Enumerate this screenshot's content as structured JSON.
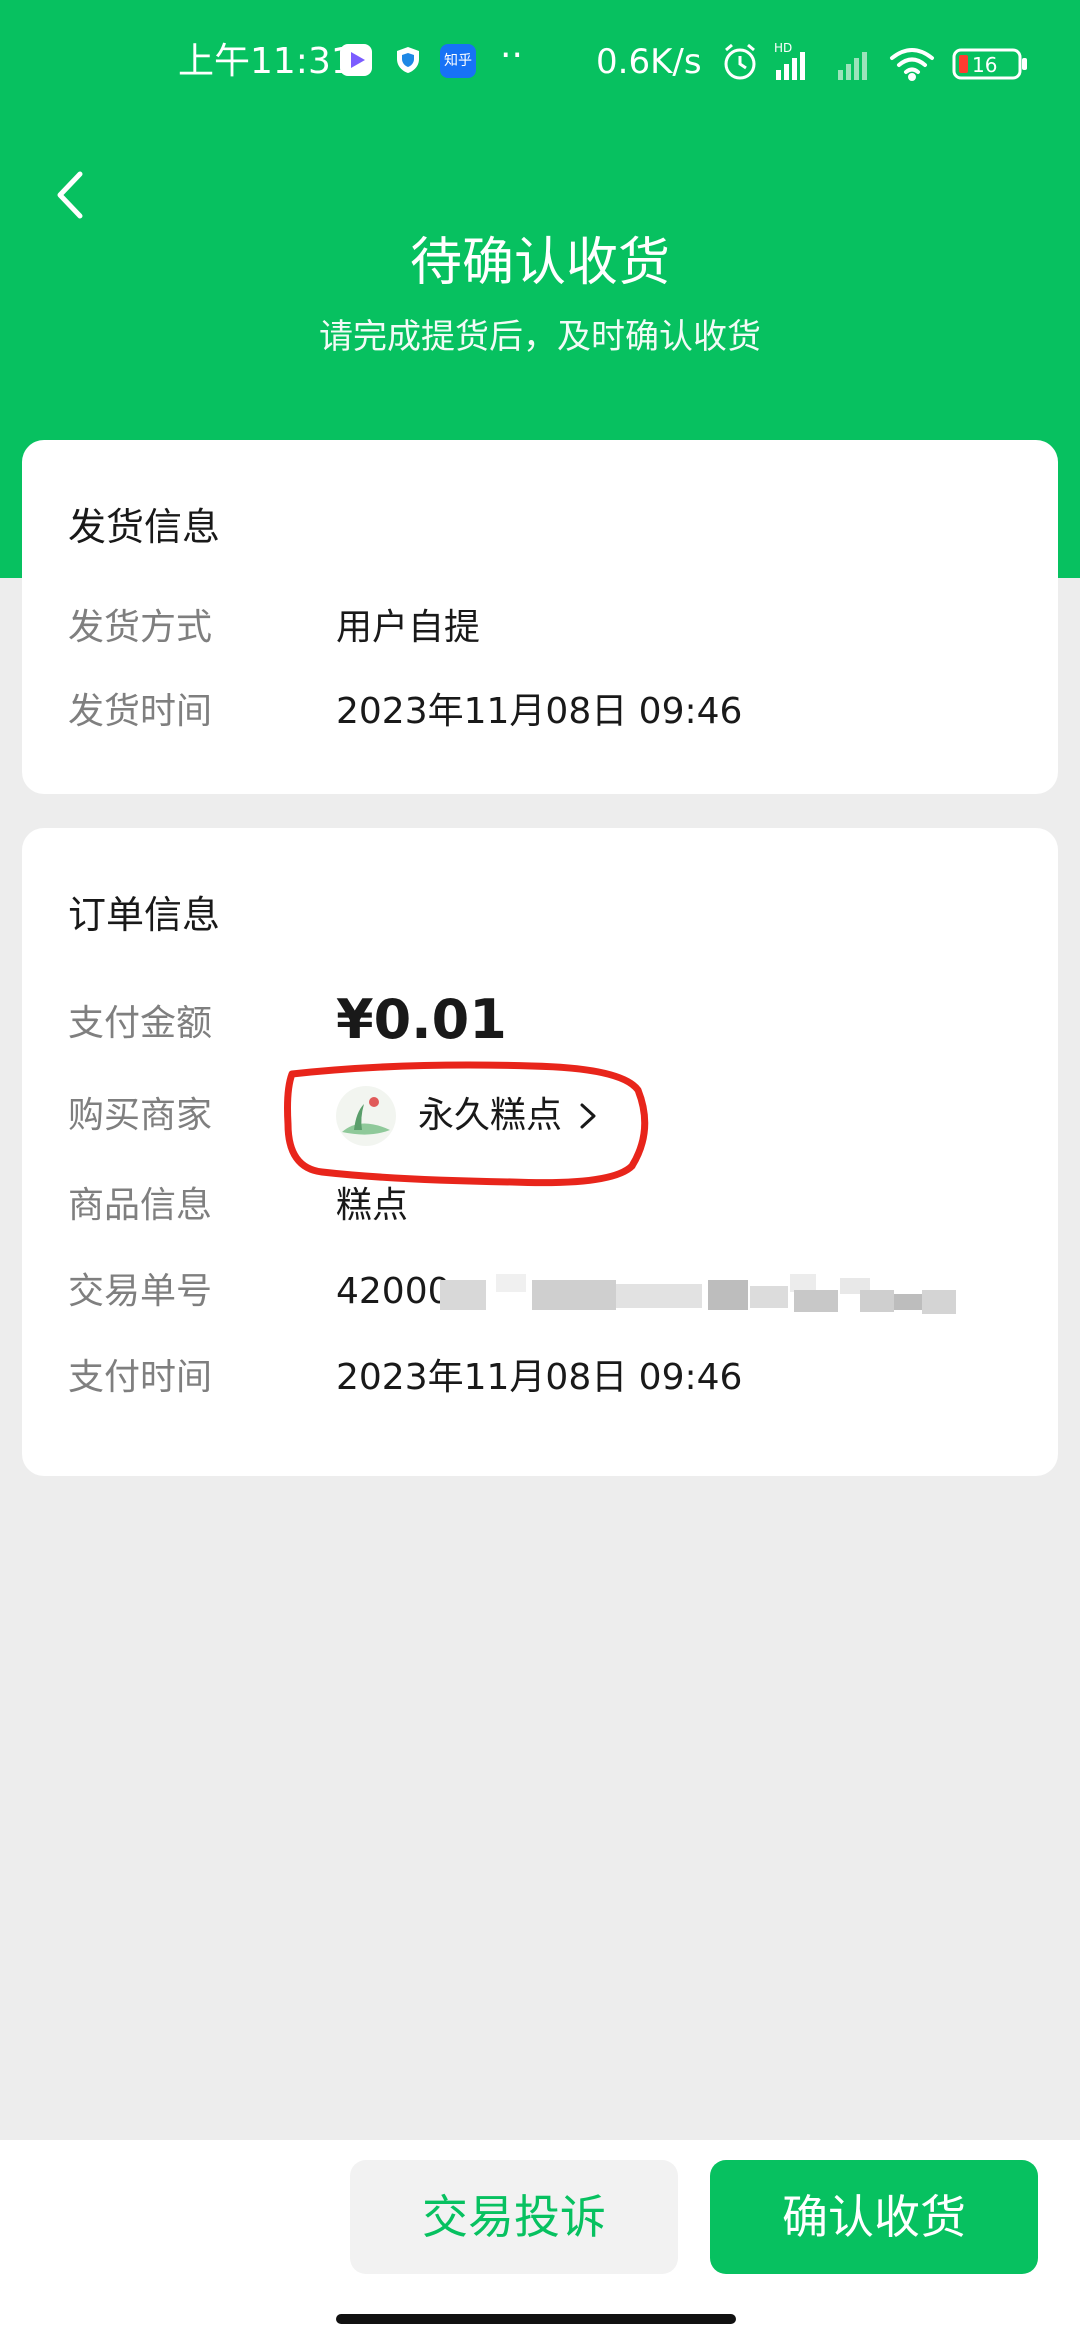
{
  "status_bar": {
    "time": "上午11:31",
    "dots": "··",
    "net_speed": "0.6K/s",
    "hd_label": "HD",
    "battery": "16",
    "app_icons": [
      "video-app-icon",
      "shield-app-icon",
      "zhihu-app-icon"
    ],
    "zhihu_label": "知乎"
  },
  "header": {
    "title": "待确认收货",
    "subtitle": "请完成提货后，及时确认收货"
  },
  "shipping": {
    "title": "发货信息",
    "method_label": "发货方式",
    "method_value": "用户自提",
    "time_label": "发货时间",
    "time_value": "2023年11月08日 09:46"
  },
  "order": {
    "title": "订单信息",
    "amount_label": "支付金额",
    "amount_value": "¥0.01",
    "merchant_label": "购买商家",
    "merchant_name": "永久糕点",
    "goods_label": "商品信息",
    "goods_value": "糕点",
    "txn_label": "交易单号",
    "txn_value_prefix": "42000",
    "pay_time_label": "支付时间",
    "pay_time_value": "2023年11月08日 09:46"
  },
  "actions": {
    "complain_label": "交易投诉",
    "confirm_label": "确认收货"
  },
  "colors": {
    "brand": "#07c160",
    "annotation": "#e8251b"
  }
}
